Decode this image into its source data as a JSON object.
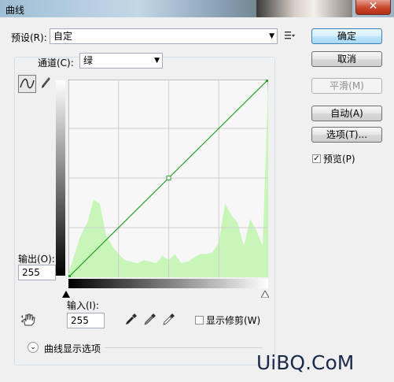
{
  "window": {
    "title": "曲线",
    "close_glyph": "✕"
  },
  "preset": {
    "label": "预设(R):",
    "value": "自定",
    "menu_icon": "list-menu-icon"
  },
  "channel": {
    "label": "通道(C):",
    "value": "绿"
  },
  "output": {
    "label": "输出(O):",
    "value": "255"
  },
  "input": {
    "label": "输入(I):",
    "value": "255"
  },
  "buttons": {
    "ok": "确定",
    "cancel": "取消",
    "smooth": "平滑(M)",
    "auto": "自动(A)",
    "options": "选项(T)..."
  },
  "preview": {
    "label": "预览(P)",
    "checked": true
  },
  "clipping": {
    "label": "显示修剪(W)",
    "checked": false
  },
  "display_options": {
    "label": "曲线显示选项"
  },
  "watermark": "UiBQ.CoM",
  "chart_data": {
    "type": "line",
    "title": "",
    "xlabel": "输入",
    "ylabel": "输出",
    "xlim": [
      0,
      255
    ],
    "ylim": [
      0,
      255
    ],
    "grid": true,
    "curve": {
      "x": [
        0,
        128,
        255
      ],
      "y": [
        0,
        128,
        255
      ]
    },
    "histogram": {
      "bins": [
        0,
        8,
        16,
        24,
        32,
        40,
        48,
        56,
        64,
        72,
        80,
        88,
        96,
        104,
        112,
        120,
        128,
        136,
        144,
        152,
        160,
        168,
        176,
        184,
        192,
        200,
        208,
        216,
        224,
        232,
        240,
        248,
        255
      ],
      "counts": [
        5,
        30,
        55,
        70,
        100,
        95,
        55,
        40,
        30,
        22,
        20,
        18,
        22,
        20,
        18,
        28,
        22,
        30,
        18,
        20,
        25,
        30,
        30,
        32,
        45,
        95,
        80,
        70,
        40,
        75,
        60,
        40,
        250
      ]
    },
    "colors": {
      "curve": "#2aa02a",
      "histogram": "#c8f5b8",
      "grid": "#cfcfcf",
      "plot_bg": "#f7f7f7"
    }
  }
}
